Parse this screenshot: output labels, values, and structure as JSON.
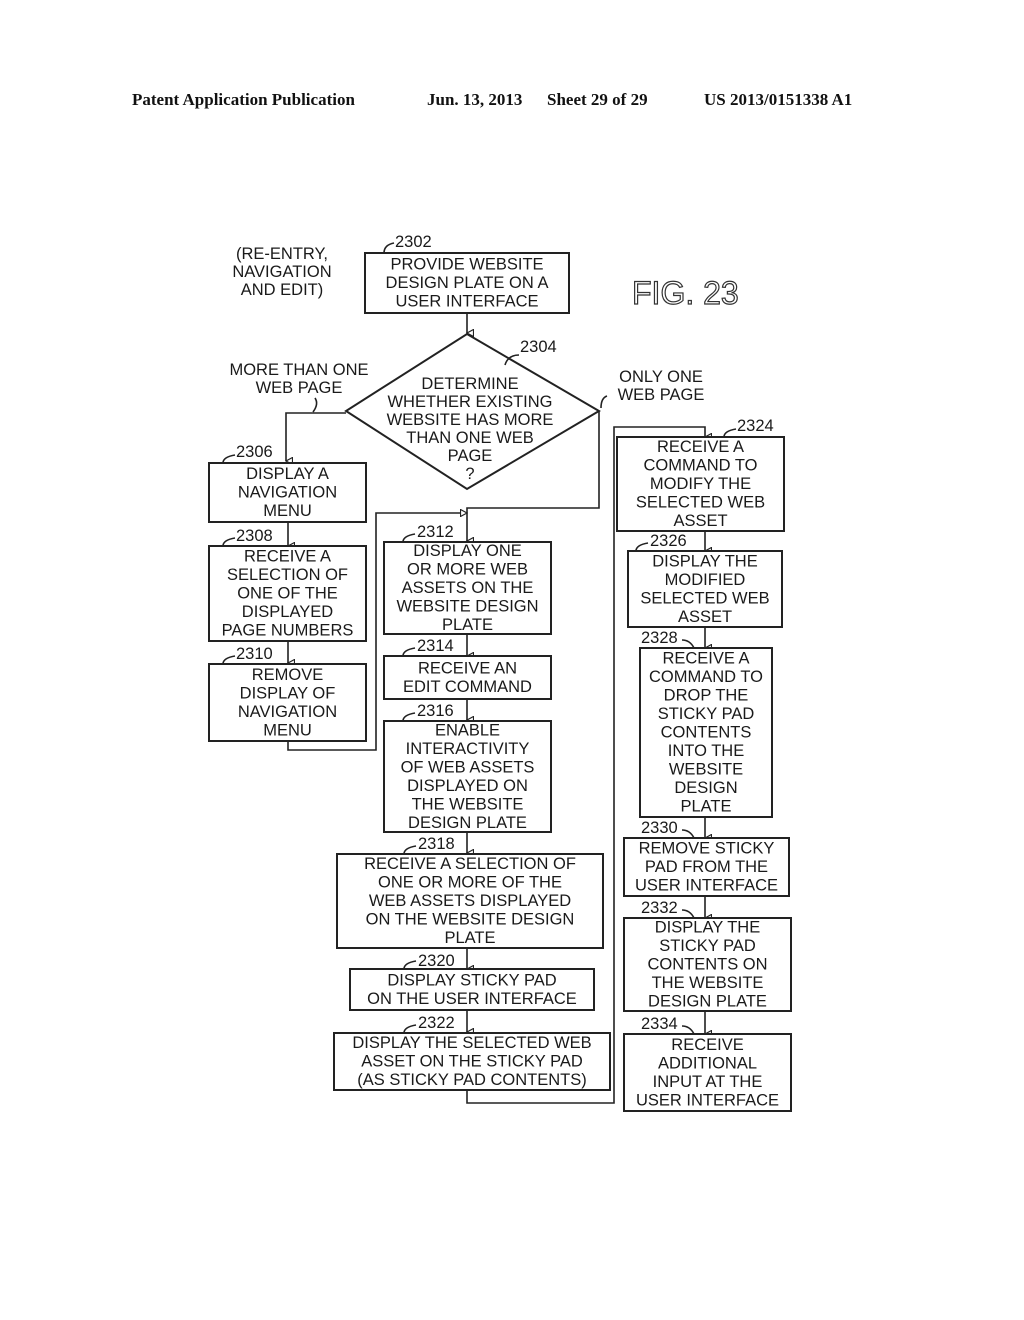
{
  "header": {
    "publication": "Patent Application Publication",
    "date": "Jun. 13, 2013",
    "sheet": "Sheet 29 of 29",
    "number": "US 2013/0151338 A1"
  },
  "figure": {
    "label": "FIG. 23",
    "caption_lines": [
      "(RE-ENTRY,",
      "NAVIGATION",
      "AND EDIT)"
    ]
  },
  "branches": {
    "more_than_one": [
      "MORE THAN ONE",
      "WEB PAGE"
    ],
    "only_one": [
      "ONLY ONE",
      "WEB PAGE"
    ]
  },
  "nodes": {
    "n2302": {
      "ref": "2302",
      "lines": [
        "PROVIDE WEBSITE",
        "DESIGN PLATE ON A",
        "USER INTERFACE"
      ]
    },
    "n2304": {
      "ref": "2304",
      "lines": [
        "DETERMINE",
        "WHETHER EXISTING",
        "WEBSITE HAS MORE",
        "THAN ONE WEB",
        "PAGE",
        "?"
      ]
    },
    "n2306": {
      "ref": "2306",
      "lines": [
        "DISPLAY A",
        "NAVIGATION",
        "MENU"
      ]
    },
    "n2308": {
      "ref": "2308",
      "lines": [
        "RECEIVE A",
        "SELECTION OF",
        "ONE OF THE",
        "DISPLAYED",
        "PAGE NUMBERS"
      ]
    },
    "n2310": {
      "ref": "2310",
      "lines": [
        "REMOVE",
        "DISPLAY OF",
        "NAVIGATION",
        "MENU"
      ]
    },
    "n2312": {
      "ref": "2312",
      "lines": [
        "DISPLAY ONE",
        "OR MORE WEB",
        "ASSETS ON THE",
        "WEBSITE DESIGN",
        "PLATE"
      ]
    },
    "n2314": {
      "ref": "2314",
      "lines": [
        "RECEIVE AN",
        "EDIT COMMAND"
      ]
    },
    "n2316": {
      "ref": "2316",
      "lines": [
        "ENABLE",
        "INTERACTIVITY",
        "OF WEB ASSETS",
        "DISPLAYED ON",
        "THE WEBSITE",
        "DESIGN PLATE"
      ]
    },
    "n2318": {
      "ref": "2318",
      "lines": [
        "RECEIVE A SELECTION OF",
        "ONE OR MORE OF THE",
        "WEB ASSETS DISPLAYED",
        "ON THE WEBSITE DESIGN",
        "PLATE"
      ]
    },
    "n2320": {
      "ref": "2320",
      "lines": [
        "DISPLAY STICKY PAD",
        "ON THE USER INTERFACE"
      ]
    },
    "n2322": {
      "ref": "2322",
      "lines": [
        "DISPLAY THE SELECTED WEB",
        "ASSET ON THE STICKY PAD",
        "(AS STICKY PAD CONTENTS)"
      ]
    },
    "n2324": {
      "ref": "2324",
      "lines": [
        "RECEIVE A",
        "COMMAND TO",
        "MODIFY THE",
        "SELECTED WEB",
        "ASSET"
      ]
    },
    "n2326": {
      "ref": "2326",
      "lines": [
        "DISPLAY THE",
        "MODIFIED",
        "SELECTED WEB",
        "ASSET"
      ]
    },
    "n2328": {
      "ref": "2328",
      "lines": [
        "RECEIVE A",
        "COMMAND TO",
        "DROP THE",
        "STICKY PAD",
        "CONTENTS",
        "INTO THE",
        "WEBSITE",
        "DESIGN",
        "PLATE"
      ]
    },
    "n2330": {
      "ref": "2330",
      "lines": [
        "REMOVE STICKY",
        "PAD FROM THE",
        "USER INTERFACE"
      ]
    },
    "n2332": {
      "ref": "2332",
      "lines": [
        "DISPLAY THE",
        "STICKY PAD",
        "CONTENTS ON",
        "THE WEBSITE",
        "DESIGN PLATE"
      ]
    },
    "n2334": {
      "ref": "2334",
      "lines": [
        "RECEIVE",
        "ADDITIONAL",
        "INPUT AT THE",
        "USER INTERFACE"
      ]
    }
  }
}
